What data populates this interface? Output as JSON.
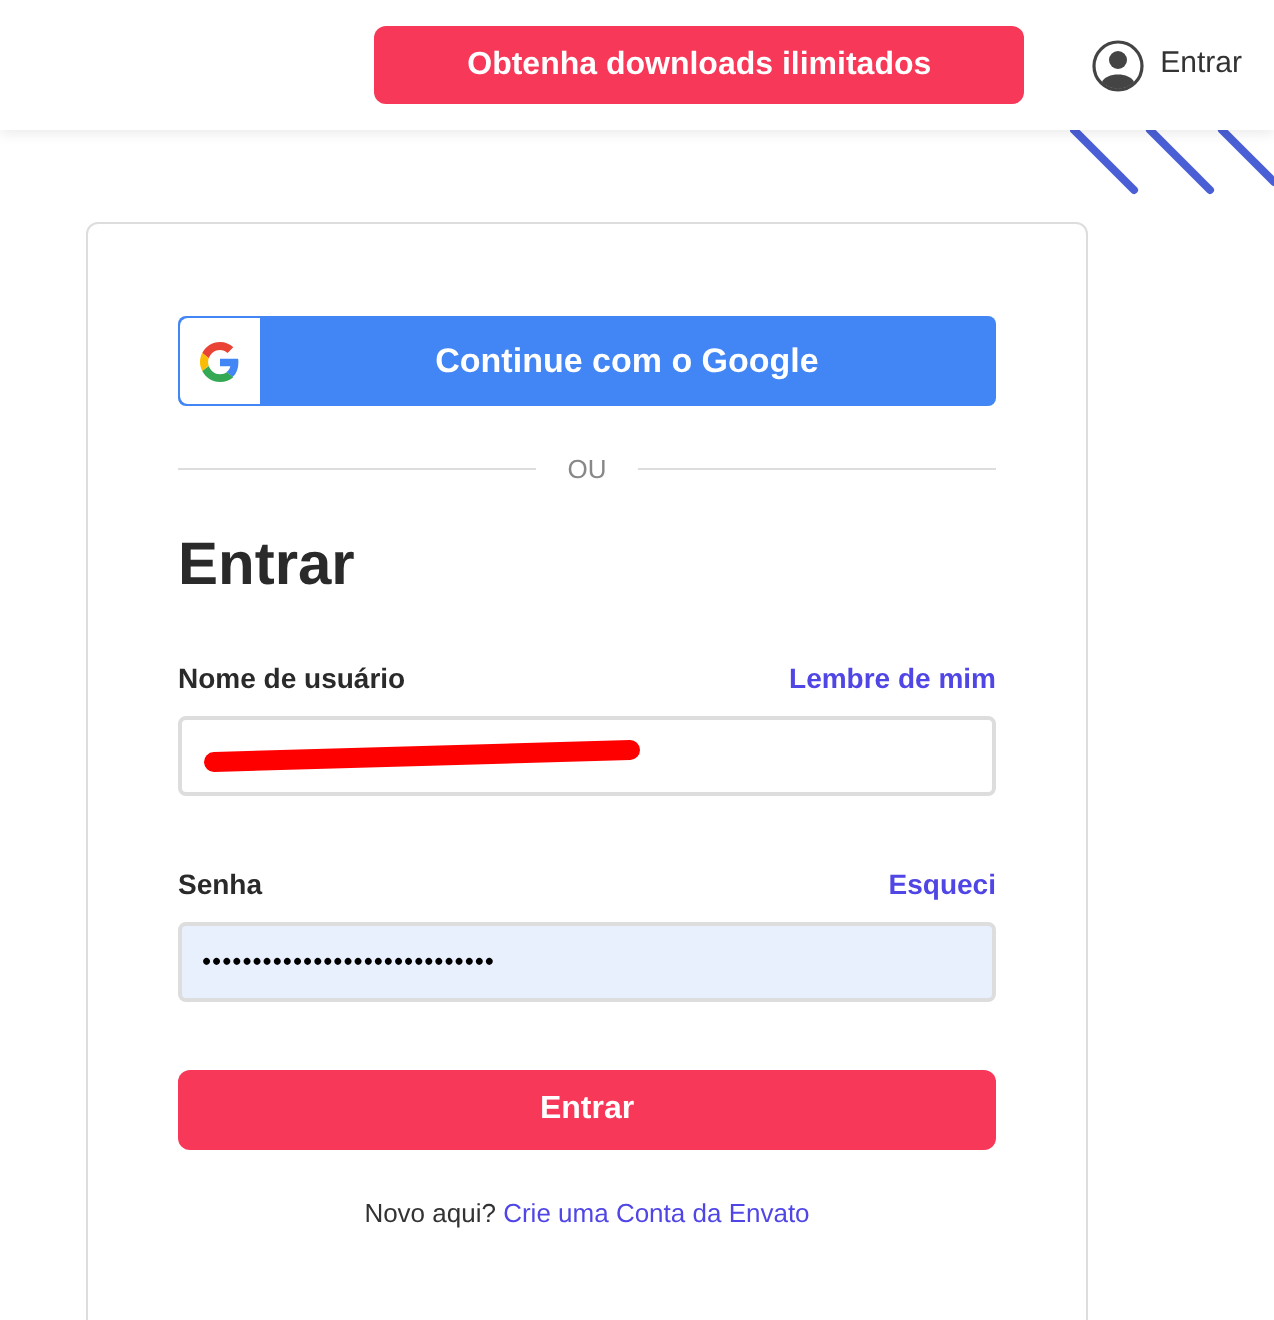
{
  "header": {
    "promo_button": "Obtenha downloads ilimitados",
    "sign_in_link": "Entrar"
  },
  "login_card": {
    "google_button": "Continue com o Google",
    "divider": "OU",
    "heading": "Entrar",
    "username_field": {
      "label": "Nome de usuário",
      "link": "Lembre de mim",
      "redacted": true,
      "autofilled": false
    },
    "password_field": {
      "label": "Senha",
      "link": "Esqueci",
      "value": "•••••••••••••••••••••••••••••",
      "autofilled": true
    },
    "submit_button": "Entrar",
    "signup_prompt": "Novo aqui?",
    "signup_link": "Crie uma Conta da Envato"
  }
}
